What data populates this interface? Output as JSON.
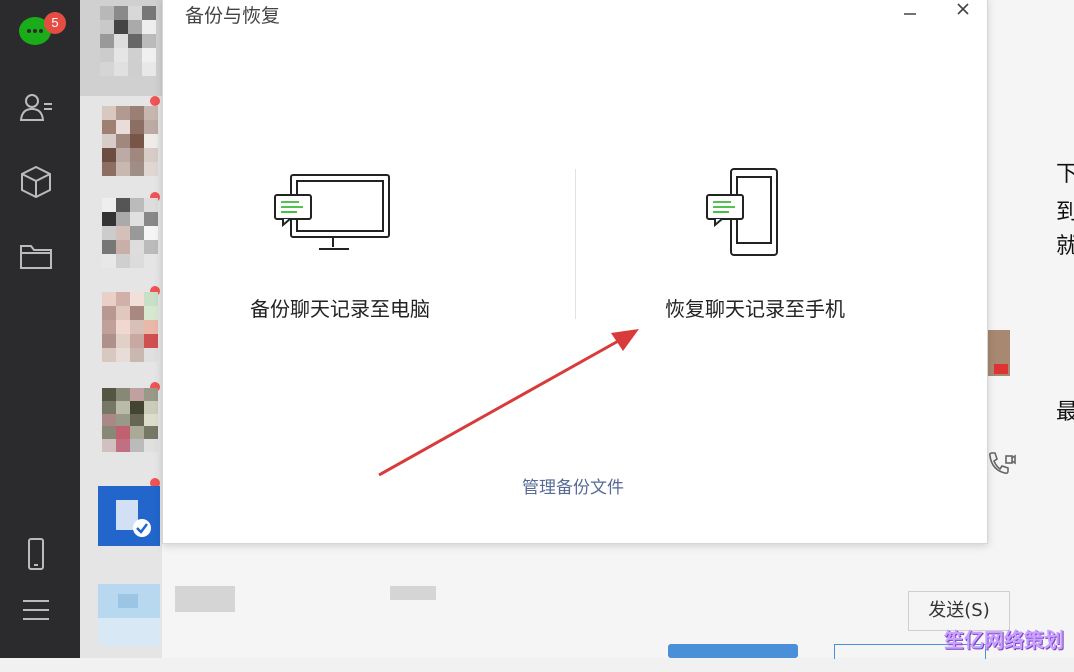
{
  "sidebar": {
    "unread_count": "5",
    "icons": [
      "chat-icon",
      "contacts-icon",
      "cube-icon",
      "folder-icon",
      "phone-icon",
      "menu-icon"
    ]
  },
  "dialog": {
    "title": "备份与恢复",
    "backup_label": "备份聊天记录至电脑",
    "restore_label": "恢复聊天记录至手机",
    "manage_link": "管理备份文件"
  },
  "chat": {
    "send_button": "发送(S)",
    "right_chars": [
      "下",
      "到",
      "就",
      "最"
    ]
  },
  "watermark": "笙亿网络策划",
  "colors": {
    "sidebar_bg": "#2b2b2e",
    "wechat_green": "#1aad19",
    "badge_red": "#e54d42",
    "link_blue": "#576b95",
    "annotation_red": "#d93a3a"
  }
}
